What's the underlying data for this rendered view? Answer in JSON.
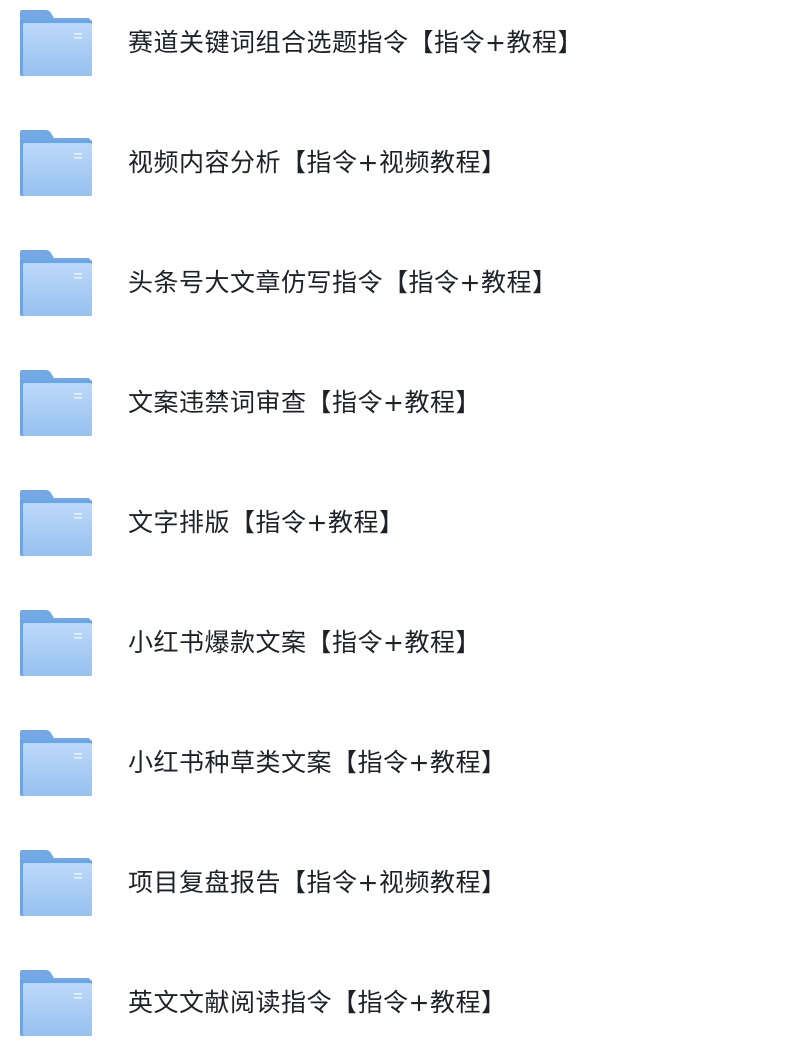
{
  "folders": [
    {
      "name": "赛道关键词组合选题指令【指令+教程】",
      "icon": "folder-icon"
    },
    {
      "name": "视频内容分析【指令+视频教程】",
      "icon": "folder-icon"
    },
    {
      "name": "头条号大文章仿写指令【指令+教程】",
      "icon": "folder-icon"
    },
    {
      "name": "文案违禁词审查【指令+教程】",
      "icon": "folder-icon"
    },
    {
      "name": "文字排版【指令+教程】",
      "icon": "folder-icon"
    },
    {
      "name": "小红书爆款文案【指令+教程】",
      "icon": "folder-icon"
    },
    {
      "name": "小红书种草类文案【指令+教程】",
      "icon": "folder-icon"
    },
    {
      "name": "项目复盘报告【指令+视频教程】",
      "icon": "folder-icon"
    },
    {
      "name": "英文文献阅读指令【指令+教程】",
      "icon": "folder-icon"
    }
  ],
  "colors": {
    "folder_back": "#7fb0ea",
    "folder_front_top": "#b9d6f7",
    "folder_front_bottom": "#9cc4f1",
    "label_text": "#1f2129"
  }
}
